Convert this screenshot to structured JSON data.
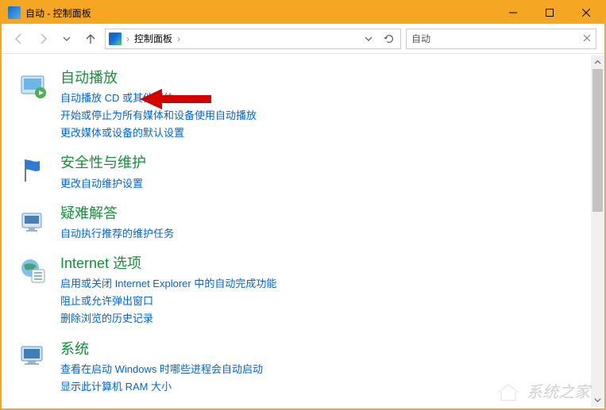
{
  "window": {
    "title": "自动 - 控制面板"
  },
  "breadcrumb": {
    "root": "控制面板"
  },
  "search": {
    "value": "自动"
  },
  "sections": [
    {
      "title": "自动播放",
      "links": [
        "自动播放 CD 或其他媒体",
        "开始或停止为所有媒体和设备使用自动播放",
        "更改媒体或设备的默认设置"
      ]
    },
    {
      "title": "安全性与维护",
      "links": [
        "更改自动维护设置"
      ]
    },
    {
      "title": "疑难解答",
      "links": [
        "自动执行推荐的维护任务"
      ]
    },
    {
      "title": "Internet 选项",
      "links": [
        "启用或关闭 Internet Explorer 中的自动完成功能",
        "阻止或允许弹出窗口",
        "删除浏览的历史记录"
      ]
    },
    {
      "title": "系统",
      "links": [
        "查看在启动 Windows 时哪些进程会自动启动",
        "显示此计算机 RAM 大小"
      ]
    }
  ],
  "watermark": "系统之家"
}
